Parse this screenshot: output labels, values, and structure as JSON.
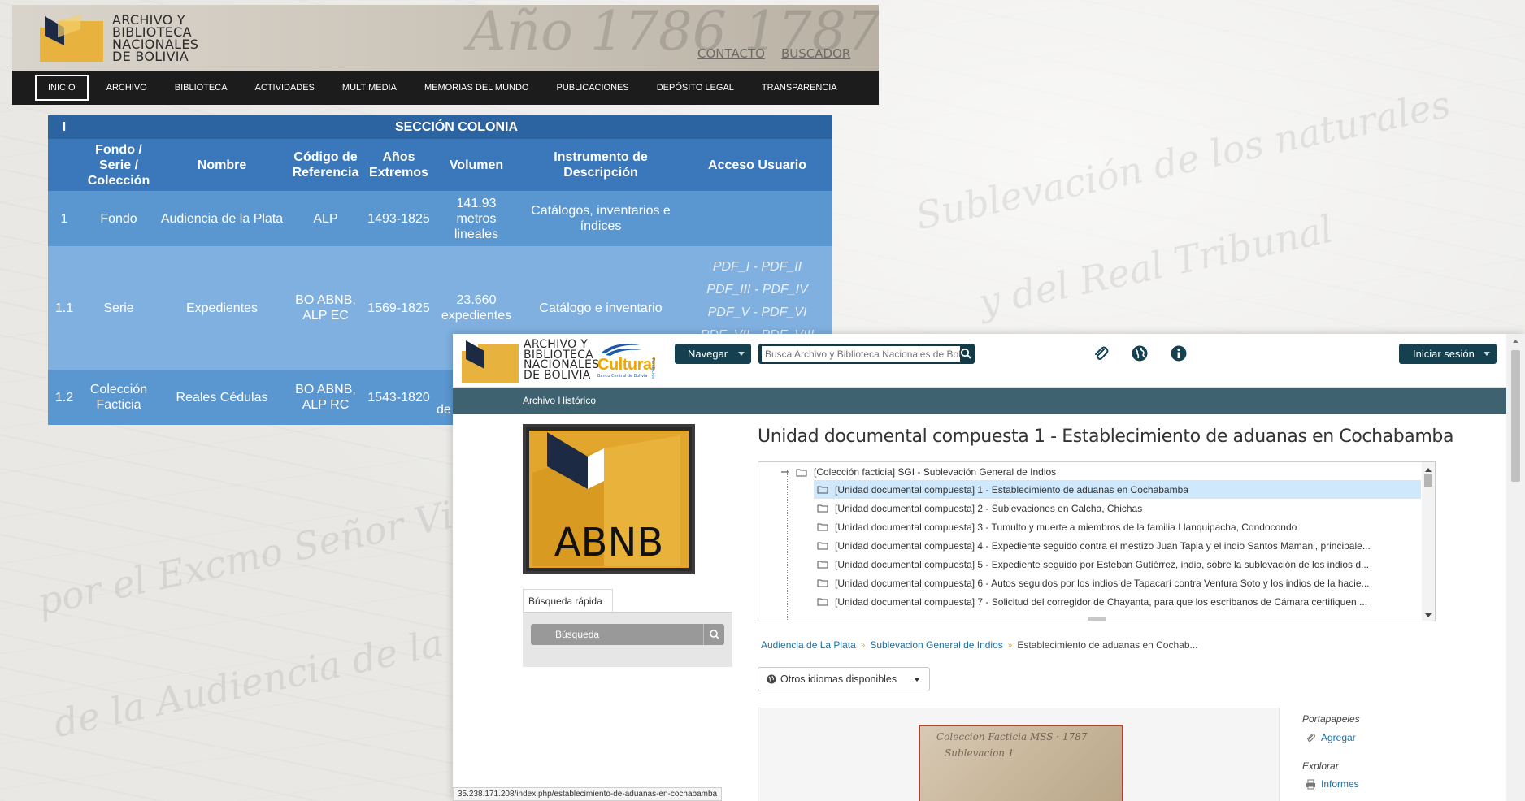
{
  "site": {
    "logo_lines": [
      "ARCHIVO Y",
      "BIBLIOTECA",
      "NACIONALES",
      "DE  BOLIVIA"
    ],
    "top_links": [
      "CONTACTO",
      "BUSCADOR"
    ],
    "nav": [
      "INICIO",
      "ARCHIVO",
      "BIBLIOTECA",
      "ACTIVIDADES",
      "MULTIMEDIA",
      "MEMORIAS DEL MUNDO",
      "PUBLICACIONES",
      "DEPÓSITO LEGAL",
      "TRANSPARENCIA"
    ],
    "active_nav": "INICIO",
    "colors": {
      "header_bg": "#cfc8bd",
      "nav_bg": "#1c1c1c"
    }
  },
  "colonia": {
    "section_num": "I",
    "section_title": "SECCIÓN COLONIA",
    "headers": [
      "",
      "Fondo / Serie / Colección",
      "Nombre",
      "Código de Referencia",
      "Años Extremos",
      "Volumen",
      "Instrumento de Descripción",
      "Acceso Usuario"
    ],
    "rows": [
      {
        "num": "1",
        "tipo": "Fondo",
        "nombre": "Audiencia de la Plata",
        "codigo": "ALP",
        "anios": "1493-1825",
        "volumen": "141.93 metros lineales",
        "instrumento": "Catálogos, inventarios e índices",
        "acceso": []
      },
      {
        "num": "1.1",
        "tipo": "Serie",
        "nombre": "Expedientes",
        "codigo": "BO ABNB, ALP EC",
        "anios": "1569-1825",
        "volumen": "23.660 expedientes",
        "instrumento": "Catálogo e inventario",
        "acceso": [
          "PDF_I - PDF_II",
          "PDF_III - PDF_IV",
          "PDF_V - PDF_VI",
          "PDF_VII - PDF_VIII"
        ]
      },
      {
        "num": "1.2",
        "tipo": "Colección Facticia",
        "nombre": "Reales Cédulas",
        "codigo": "BO ABNB, ALP RC",
        "anios": "1543-1820",
        "volumen": "de",
        "instrumento": "",
        "acceso": []
      }
    ],
    "colors": {
      "title": "#2b64a1",
      "header": "#3a78bb",
      "row_dark": "#5a96d0",
      "row_light": "#7fb0df"
    }
  },
  "atom": {
    "header_logo_lines": [
      "ARCHIVO Y",
      "BIBLIOTECA",
      "NACIONALES",
      "DE BOLIVIA"
    ],
    "cultural_logo": {
      "word": "Cultural",
      "top": "Fundación",
      "sub": "Banco Central de Bolivia"
    },
    "navegar_label": "Navegar",
    "search_placeholder": "Busca Archivo y Biblioteca Nacionales de Bolivia",
    "header_icons": [
      "clipboard-icon",
      "globe-icon",
      "info-icon"
    ],
    "login_label": "Iniciar sesión",
    "subbar_label": "Archivo Histórico",
    "logo_text": "ABNB",
    "quick_search": {
      "tab_label": "Búsqueda rápida",
      "placeholder": "Búsqueda"
    },
    "title": "Unidad documental compuesta 1 - Establecimiento de aduanas en Cochabamba",
    "tree": {
      "parent": "[Colección facticia] SGI - Sublevación General de Indios",
      "items": [
        "[Unidad documental compuesta] 1 - Establecimiento de aduanas en Cochabamba",
        "[Unidad documental compuesta] 2 - Sublevaciones en Calcha, Chichas",
        "[Unidad documental compuesta] 3 - Tumulto y muerte a miembros de la familia Llanquipacha, Condocondo",
        "[Unidad documental compuesta] 4 - Expediente seguido contra el mestizo Juan Tapia y el indio Santos Mamani, principale...",
        "[Unidad documental compuesta] 5 - Expediente seguido por Esteban Gutiérrez, indio, sobre la sublevación de los indios d...",
        "[Unidad documental compuesta] 6 - Autos seguidos por los indios de Tapacarí contra Ventura Soto y los indios de la hacie...",
        "[Unidad documental compuesta] 7 - Solicitud del corregidor de Chayanta, para que los escribanos de Cámara certifiquen ..."
      ],
      "selected_index": 0
    },
    "breadcrumbs": [
      "Audiencia de La Plata",
      "Sublevacion General de Indios",
      "Establecimiento de aduanas en Cochab..."
    ],
    "otros_idiomas": "Otros idiomas disponibles",
    "sidebar": {
      "portapapeles": "Portapapeles",
      "agregar": "Agregar",
      "explorar": "Explorar",
      "informes": "Informes"
    },
    "status_url": "35.238.171.208/index.php/establecimiento-de-aduanas-en-cochabamba",
    "colors": {
      "primary": "#154050",
      "subbar": "#3f6270",
      "link": "#1d6fa5",
      "selected": "#cfe8fb",
      "logo_gold": "#e8b23f"
    }
  }
}
